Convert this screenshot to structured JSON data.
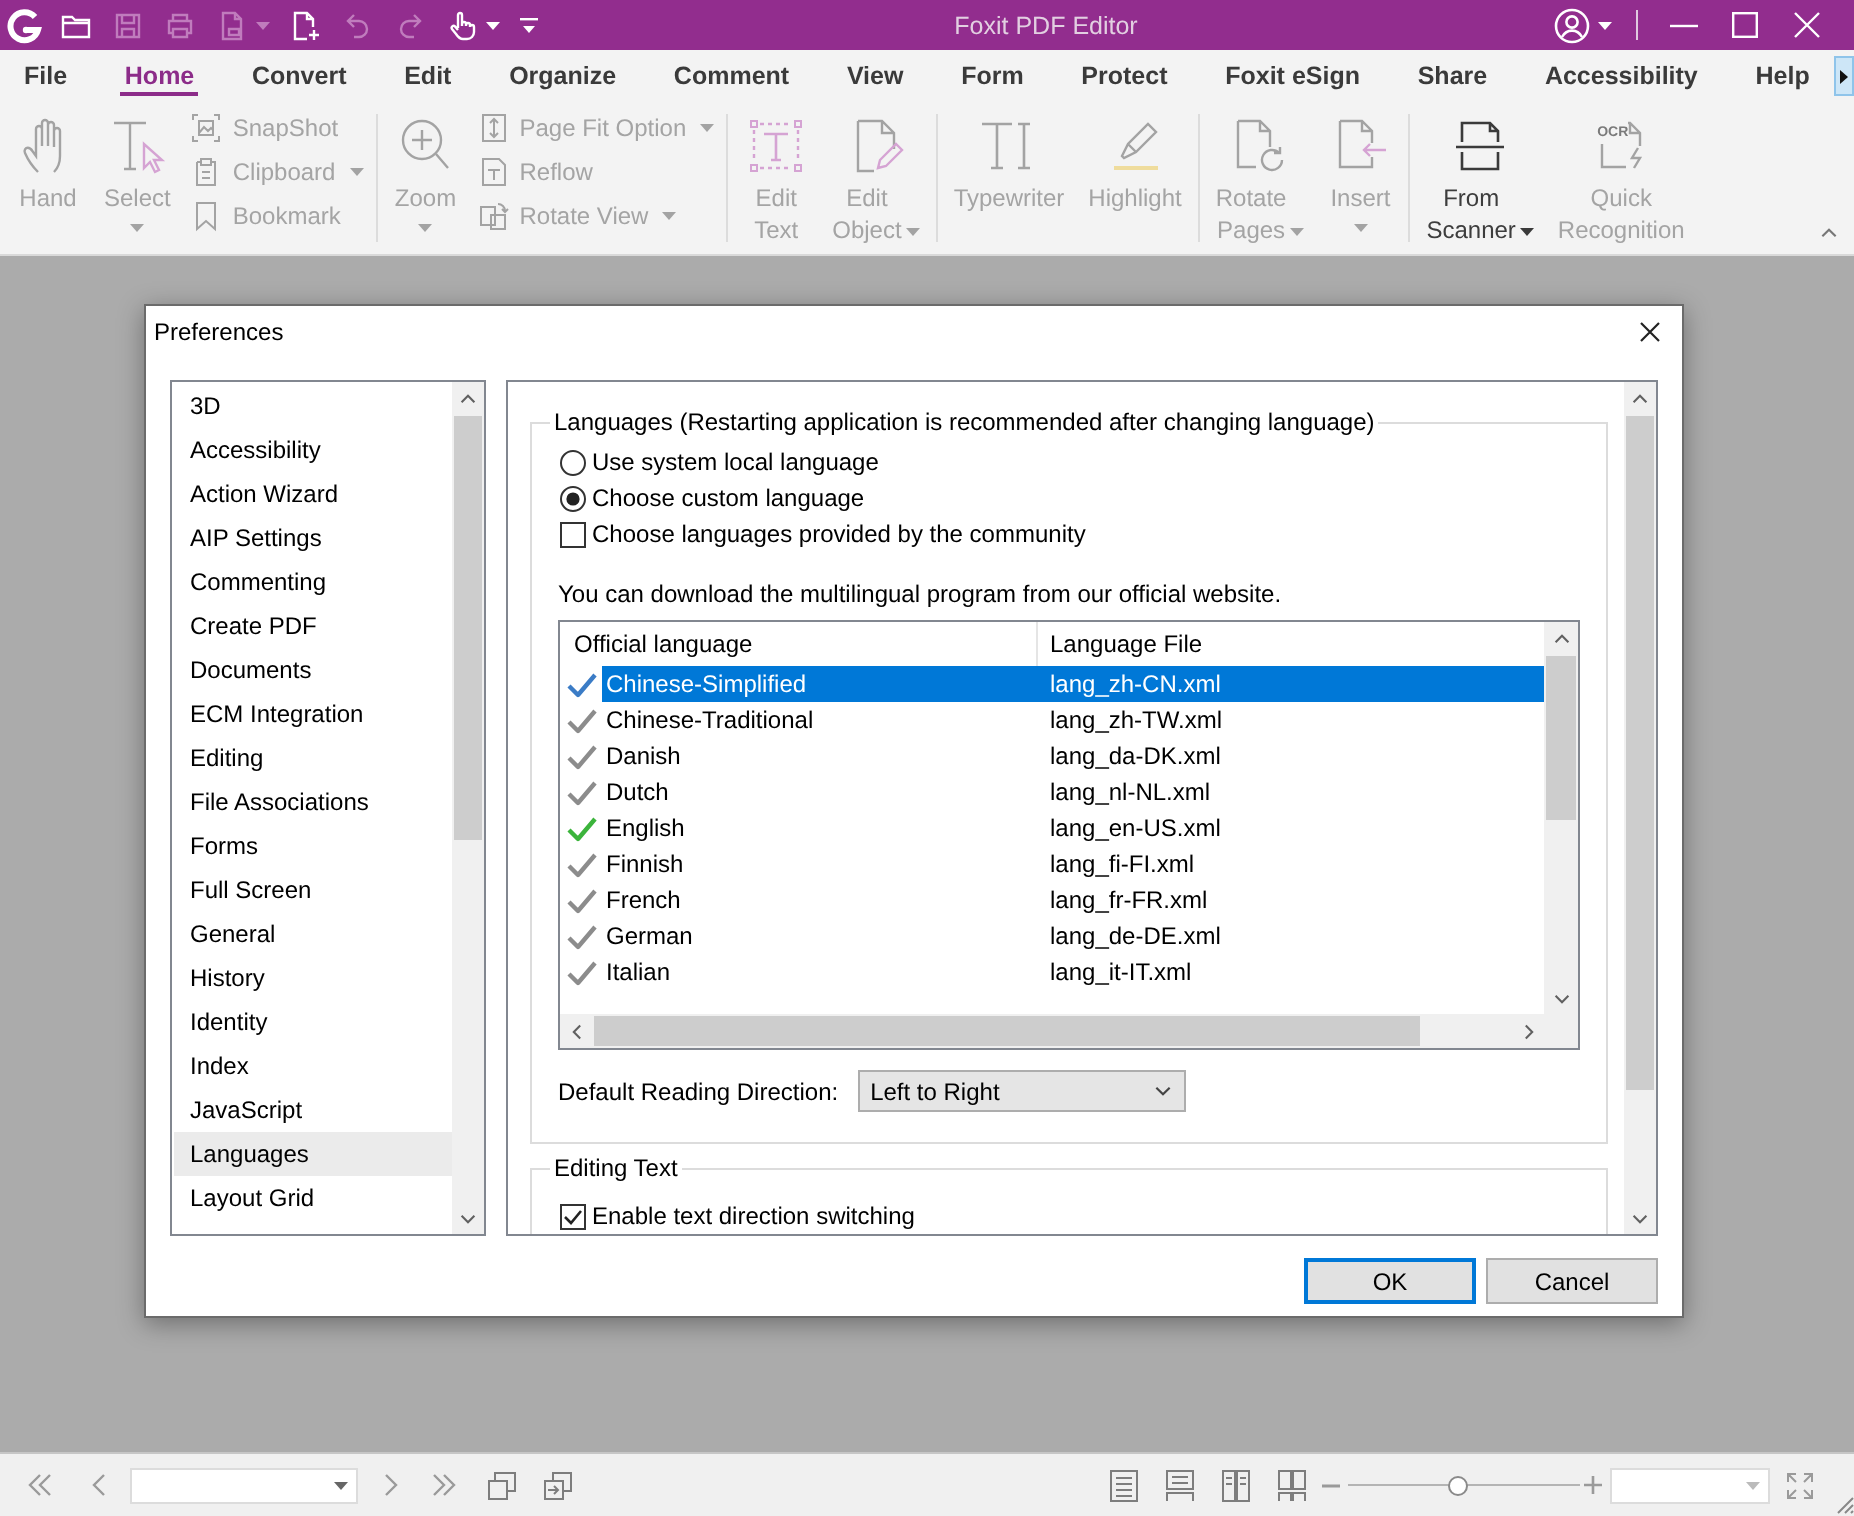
{
  "window": {
    "title": "Foxit PDF Editor"
  },
  "quick_access": [
    {
      "disabled": false,
      "dropdown": false
    },
    {
      "disabled": true,
      "dropdown": false
    },
    {
      "disabled": true,
      "dropdown": false
    },
    {
      "disabled": true,
      "dropdown": true
    },
    {
      "disabled": false,
      "dropdown": false
    },
    {
      "disabled": true,
      "dropdown": false
    },
    {
      "disabled": true,
      "dropdown": false
    },
    {
      "disabled": false,
      "dropdown": true
    },
    {
      "disabled": false,
      "dropdown": false
    }
  ],
  "ribbon_tabs": [
    {
      "label": "File",
      "selected": false
    },
    {
      "label": "Home",
      "selected": true
    },
    {
      "label": "Convert",
      "selected": false
    },
    {
      "label": "Edit",
      "selected": false
    },
    {
      "label": "Organize",
      "selected": false
    },
    {
      "label": "Comment",
      "selected": false
    },
    {
      "label": "View",
      "selected": false
    },
    {
      "label": "Form",
      "selected": false
    },
    {
      "label": "Protect",
      "selected": false
    },
    {
      "label": "Foxit eSign",
      "selected": false
    },
    {
      "label": "Share",
      "selected": false
    },
    {
      "label": "Accessibility",
      "selected": false
    },
    {
      "label": "Help",
      "selected": false
    }
  ],
  "ribbon": {
    "groups": [
      {
        "items": [
          {
            "kind": "large",
            "label": "Hand",
            "disabled": true,
            "dropdown": false
          },
          {
            "kind": "large",
            "label": "Select",
            "disabled": true,
            "dropdown": true
          },
          {
            "kind": "small",
            "label": "SnapShot",
            "disabled": true,
            "dropdown": false
          },
          {
            "kind": "small",
            "label": "Clipboard",
            "disabled": true,
            "dropdown": true
          },
          {
            "kind": "small",
            "label": "Bookmark",
            "disabled": true,
            "dropdown": false
          }
        ]
      },
      {
        "items": [
          {
            "kind": "large",
            "label": "Zoom",
            "disabled": true,
            "dropdown": true
          },
          {
            "kind": "small",
            "label": "Page Fit Option",
            "disabled": true,
            "dropdown": true
          },
          {
            "kind": "small",
            "label": "Reflow",
            "disabled": true,
            "dropdown": false
          },
          {
            "kind": "small",
            "label": "Rotate View",
            "disabled": true,
            "dropdown": true
          }
        ]
      },
      {
        "items": [
          {
            "kind": "large",
            "label": "Edit Text",
            "disabled": true,
            "dropdown": false
          },
          {
            "kind": "large",
            "label": "Edit Object",
            "disabled": true,
            "dropdown": true
          }
        ]
      },
      {
        "items": [
          {
            "kind": "large",
            "label": "Typewriter",
            "disabled": true,
            "dropdown": false
          },
          {
            "kind": "large",
            "label": "Highlight",
            "disabled": true,
            "dropdown": false
          }
        ]
      },
      {
        "items": [
          {
            "kind": "large",
            "label": "Rotate Pages",
            "disabled": true,
            "dropdown": true
          },
          {
            "kind": "large",
            "label": "Insert",
            "disabled": true,
            "dropdown": true
          }
        ]
      },
      {
        "items": [
          {
            "kind": "large",
            "label": "From Scanner",
            "disabled": false,
            "dropdown": true
          },
          {
            "kind": "large",
            "label": "Quick Recognition",
            "disabled": true,
            "dropdown": false,
            "icon_text": "OCR"
          }
        ]
      }
    ]
  },
  "dialog": {
    "title": "Preferences",
    "categories": [
      {
        "label": "3D",
        "selected": false
      },
      {
        "label": "Accessibility",
        "selected": false
      },
      {
        "label": "Action Wizard",
        "selected": false
      },
      {
        "label": "AIP Settings",
        "selected": false
      },
      {
        "label": "Commenting",
        "selected": false
      },
      {
        "label": "Create PDF",
        "selected": false
      },
      {
        "label": "Documents",
        "selected": false
      },
      {
        "label": "ECM Integration",
        "selected": false
      },
      {
        "label": "Editing",
        "selected": false
      },
      {
        "label": "File Associations",
        "selected": false
      },
      {
        "label": "Forms",
        "selected": false
      },
      {
        "label": "Full Screen",
        "selected": false
      },
      {
        "label": "General",
        "selected": false
      },
      {
        "label": "History",
        "selected": false
      },
      {
        "label": "Identity",
        "selected": false
      },
      {
        "label": "Index",
        "selected": false
      },
      {
        "label": "JavaScript",
        "selected": false
      },
      {
        "label": "Languages",
        "selected": true
      },
      {
        "label": "Layout Grid",
        "selected": false
      }
    ],
    "languages_group": {
      "legend": "Languages (Restarting application is recommended after changing language)",
      "options": [
        {
          "kind": "radio",
          "label": "Use system local language",
          "selected": false
        },
        {
          "kind": "radio",
          "label": "Choose custom language",
          "selected": true
        },
        {
          "kind": "checkbox",
          "label": "Choose languages provided by the community",
          "checked": false
        }
      ],
      "note": "You can download the multilingual program from our official website.",
      "table": {
        "columns": [
          "Official language",
          "Language File"
        ],
        "rows": [
          {
            "language": "Chinese-Simplified",
            "file": "lang_zh-CN.xml",
            "selected": true,
            "color": "#3b7cc6"
          },
          {
            "language": "Chinese-Traditional",
            "file": "lang_zh-TW.xml",
            "selected": false,
            "color": "#8c8c8c"
          },
          {
            "language": "Danish",
            "file": "lang_da-DK.xml",
            "selected": false,
            "color": "#8c8c8c"
          },
          {
            "language": "Dutch",
            "file": "lang_nl-NL.xml",
            "selected": false,
            "color": "#8c8c8c"
          },
          {
            "language": "English",
            "file": "lang_en-US.xml",
            "selected": false,
            "color": "#3cb43c"
          },
          {
            "language": "Finnish",
            "file": "lang_fi-FI.xml",
            "selected": false,
            "color": "#8c8c8c"
          },
          {
            "language": "French",
            "file": "lang_fr-FR.xml",
            "selected": false,
            "color": "#8c8c8c"
          },
          {
            "language": "German",
            "file": "lang_de-DE.xml",
            "selected": false,
            "color": "#8c8c8c"
          },
          {
            "language": "Italian",
            "file": "lang_it-IT.xml",
            "selected": false,
            "color": "#8c8c8c"
          }
        ]
      },
      "reading_direction": {
        "label": "Default Reading Direction:",
        "value": "Left to Right"
      }
    },
    "editing_text_group": {
      "legend": "Editing Text",
      "options": [
        {
          "kind": "checkbox",
          "label": "Enable text direction switching",
          "checked": true
        }
      ]
    },
    "buttons": [
      {
        "label": "OK",
        "default": true
      },
      {
        "label": "Cancel",
        "default": false
      }
    ]
  },
  "status_bar": {
    "zoom_slider": {
      "level": 0.47
    }
  }
}
